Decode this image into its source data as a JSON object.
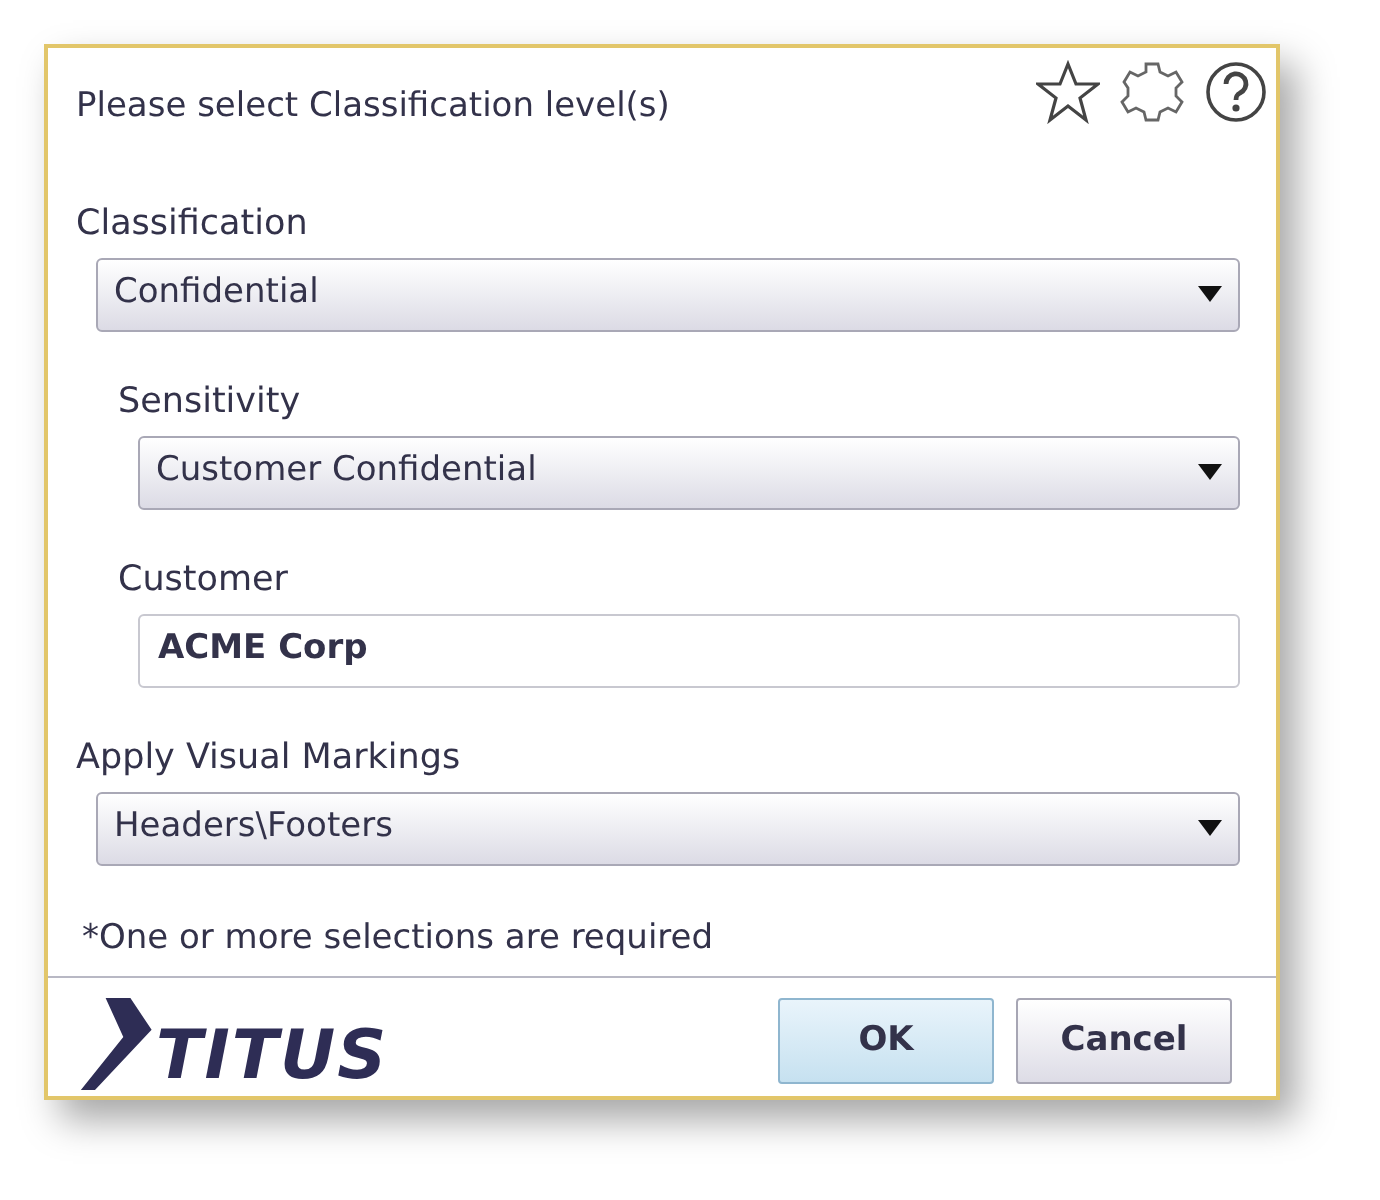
{
  "dialog": {
    "title": "Please select Classification level(s)"
  },
  "fields": [
    {
      "kind": "select",
      "label": "Classification",
      "value": "Confidential",
      "children": [
        {
          "kind": "select",
          "label": "Sensitivity",
          "value": "Customer Confidential"
        },
        {
          "kind": "text",
          "label": "Customer",
          "value": "ACME Corp"
        }
      ]
    },
    {
      "kind": "select",
      "label": "Apply Visual Markings",
      "value": "Headers\\Footers"
    }
  ],
  "note": "*One or more selections are required",
  "logo": {
    "text": "TITUS"
  },
  "buttons": [
    {
      "label": "OK",
      "default": true
    },
    {
      "label": "Cancel",
      "default": false
    }
  ]
}
